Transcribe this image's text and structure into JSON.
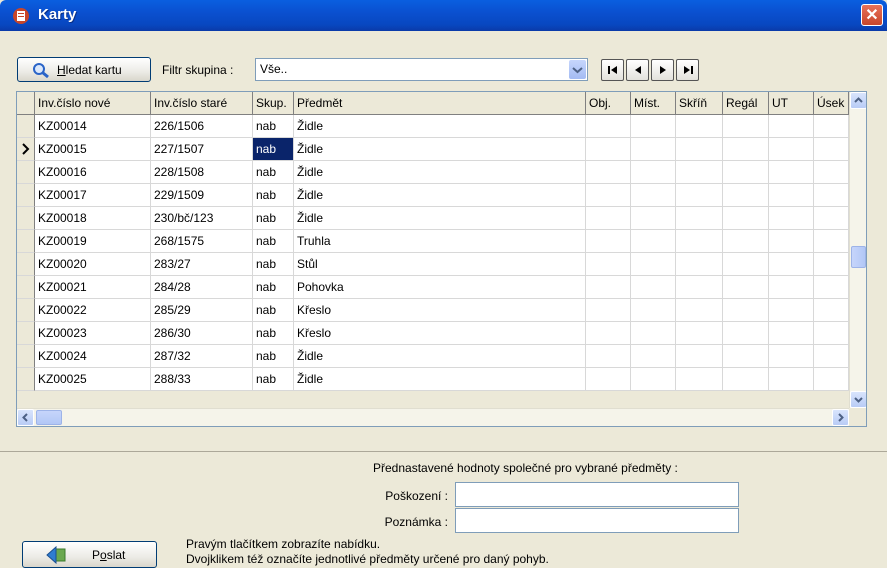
{
  "window": {
    "title": "Karty",
    "close_symbol": "✕"
  },
  "toolbar": {
    "search_button_label": "Hledat kartu",
    "filter_label": "Filtr skupina :",
    "filter_value": "Vše.."
  },
  "table": {
    "columns": [
      "Inv.číslo nové",
      "Inv.číslo staré",
      "Skup.",
      "Předmět",
      "Obj.",
      "Míst.",
      "Skříň",
      "Regál",
      "UT",
      "Úsek"
    ],
    "rows": [
      [
        "KZ00014",
        "226/1506",
        "nab",
        "Židle"
      ],
      [
        "KZ00015",
        "227/1507",
        "nab",
        "Židle"
      ],
      [
        "KZ00016",
        "228/1508",
        "nab",
        "Židle"
      ],
      [
        "KZ00017",
        "229/1509",
        "nab",
        "Židle"
      ],
      [
        "KZ00018",
        "230/bč/123",
        "nab",
        "Židle"
      ],
      [
        "KZ00019",
        "268/1575",
        "nab",
        "Truhla"
      ],
      [
        "KZ00020",
        "283/27",
        "nab",
        "Stůl"
      ],
      [
        "KZ00021",
        "284/28",
        "nab",
        "Pohovka"
      ],
      [
        "KZ00022",
        "285/29",
        "nab",
        "Křeslo"
      ],
      [
        "KZ00023",
        "286/30",
        "nab",
        "Křeslo"
      ],
      [
        "KZ00024",
        "287/32",
        "nab",
        "Židle"
      ],
      [
        "KZ00025",
        "288/33",
        "nab",
        "Židle"
      ]
    ],
    "current_row_index": 1,
    "selected_cell_column": 2
  },
  "defaults": {
    "title": "Přednastavené hodnoty společné pro vybrané předměty :",
    "damage_label": "Poškození :",
    "damage_value": "",
    "note_label": "Poznámka :",
    "note_value": ""
  },
  "footer": {
    "send_button_label": "Poslat",
    "hint_line1": "Pravým tlačítkem zobrazíte nabídku.",
    "hint_line2": "Dvojklikem též označíte jednotlivé předměty určené pro daný pohyb."
  },
  "icons": [
    "app-icon",
    "close-icon",
    "search-icon",
    "dropdown-arrow-icon",
    "first-record-icon",
    "prev-record-icon",
    "next-record-icon",
    "last-record-icon",
    "row-indicator-icon",
    "send-icon"
  ],
  "colors": {
    "titlebar": "#0a50d0",
    "selection": "#0a246a",
    "window_bg": "#ece9d8"
  }
}
